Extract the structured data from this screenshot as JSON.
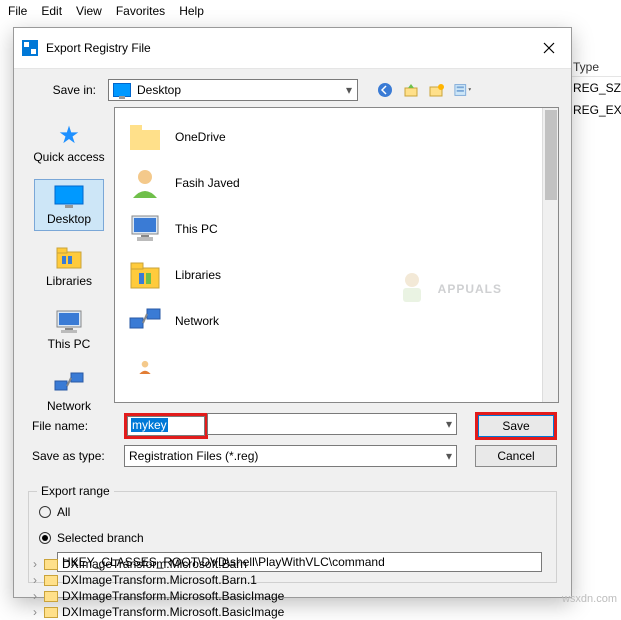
{
  "menubar": {
    "items": [
      "File",
      "Edit",
      "View",
      "Favorites",
      "Help"
    ]
  },
  "behind": {
    "header": "Type",
    "rows": [
      "REG_SZ",
      "REG_EXPAND"
    ]
  },
  "dialog": {
    "title": "Export Registry File",
    "savein": {
      "label": "Save in:",
      "value": "Desktop"
    },
    "toolbar_icons": [
      "back-icon",
      "up-icon",
      "new-folder-icon",
      "views-icon"
    ],
    "places": [
      {
        "label": "Quick access",
        "icon": "star"
      },
      {
        "label": "Desktop",
        "icon": "monitor",
        "selected": true
      },
      {
        "label": "Libraries",
        "icon": "lib"
      },
      {
        "label": "This PC",
        "icon": "pc"
      },
      {
        "label": "Network",
        "icon": "net"
      }
    ],
    "items": [
      {
        "label": "OneDrive",
        "icon": "folder"
      },
      {
        "label": "Fasih Javed",
        "icon": "user"
      },
      {
        "label": "This PC",
        "icon": "pc"
      },
      {
        "label": "Libraries",
        "icon": "lib"
      },
      {
        "label": "Network",
        "icon": "neticon"
      }
    ],
    "watermark": "APPUALS",
    "filename_label": "File name:",
    "filename_value": "mykey",
    "saveas_label": "Save as type:",
    "saveas_value": "Registration Files (*.reg)",
    "buttons": {
      "save": "Save",
      "cancel": "Cancel"
    },
    "export": {
      "legend": "Export range",
      "all": "All",
      "selected": "Selected branch",
      "path": "HKEY_CLASSES_ROOT\\DVD\\shell\\PlayWithVLC\\command"
    }
  },
  "tree": {
    "items": [
      "DXImageTransform.Microsoft.Barn",
      "DXImageTransform.Microsoft.Barn.1",
      "DXImageTransform.Microsoft.BasicImage",
      "DXImageTransform.Microsoft.BasicImage"
    ]
  },
  "credit": "wsxdn.com"
}
